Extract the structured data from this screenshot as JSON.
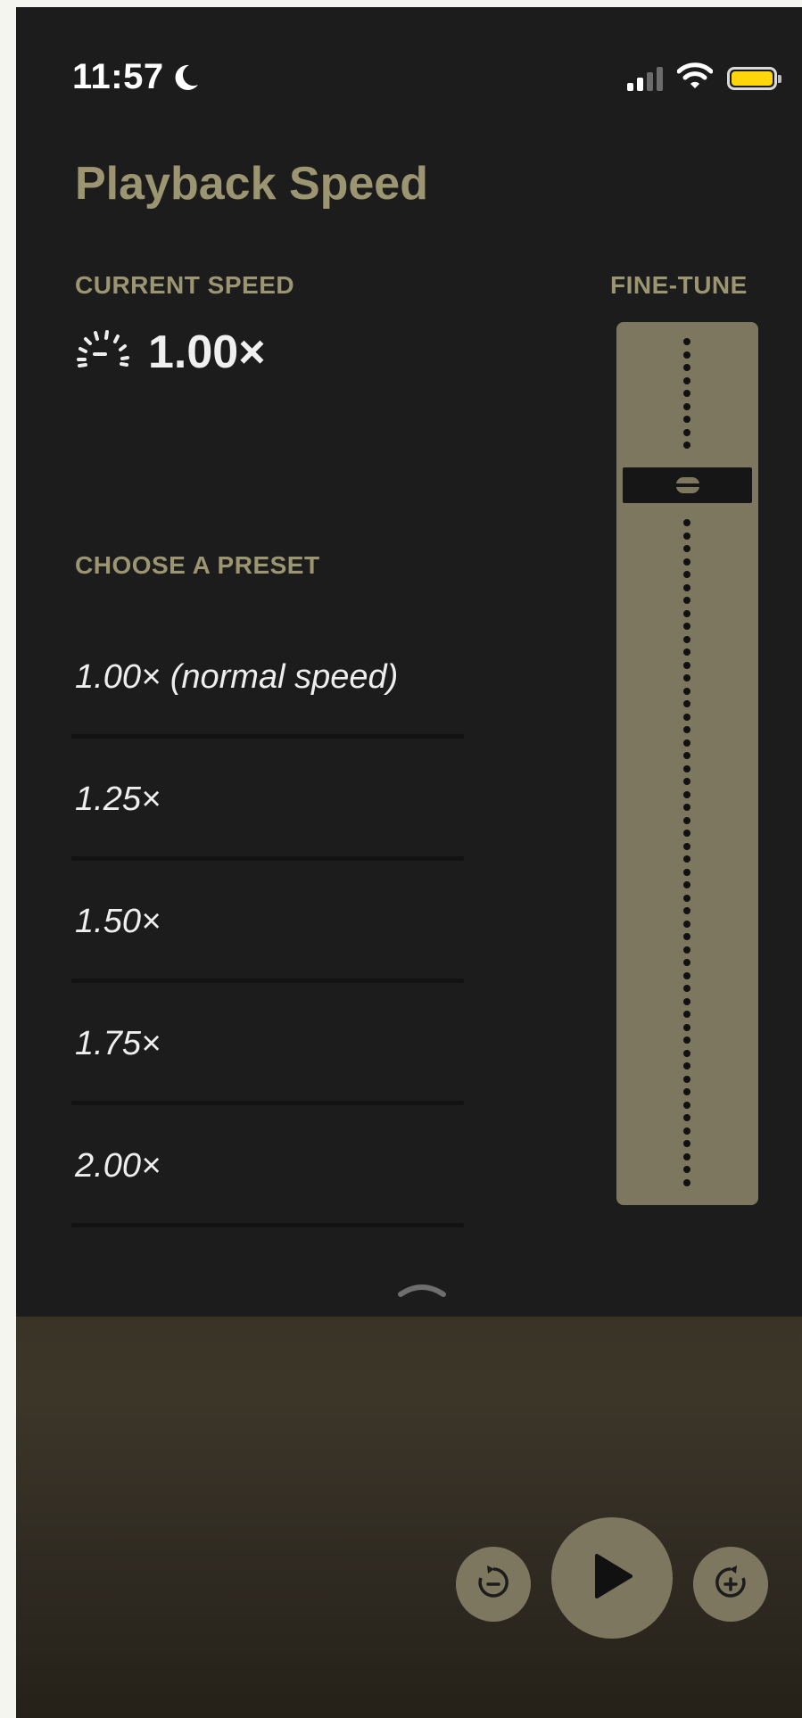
{
  "status_bar": {
    "time": "11:57",
    "focus_icon": "moon-icon",
    "signal_icon": "cellular-signal-icon",
    "wifi_icon": "wifi-icon",
    "battery_icon": "battery-icon",
    "battery_color": "#ffd60a"
  },
  "page": {
    "title": "Playback Speed"
  },
  "current_speed": {
    "label": "CURRENT SPEED",
    "icon": "speedometer-icon",
    "value": "1.00×"
  },
  "fine_tune": {
    "label": "FINE-TUNE",
    "thumb_position": 0.17
  },
  "presets": {
    "label": "CHOOSE A PRESET",
    "items": [
      {
        "label": "1.00× (normal speed)"
      },
      {
        "label": "1.25×"
      },
      {
        "label": "1.50×"
      },
      {
        "label": "1.75×"
      },
      {
        "label": "2.00×"
      }
    ]
  },
  "collapse_icon": "chevron-up-icon",
  "player": {
    "skip_back_icon": "skip-back-icon",
    "play_icon": "play-icon",
    "skip_forward_icon": "skip-forward-icon"
  },
  "colors": {
    "accent": "#9c9571",
    "background": "#1c1c1c",
    "control": "#7d775f"
  }
}
